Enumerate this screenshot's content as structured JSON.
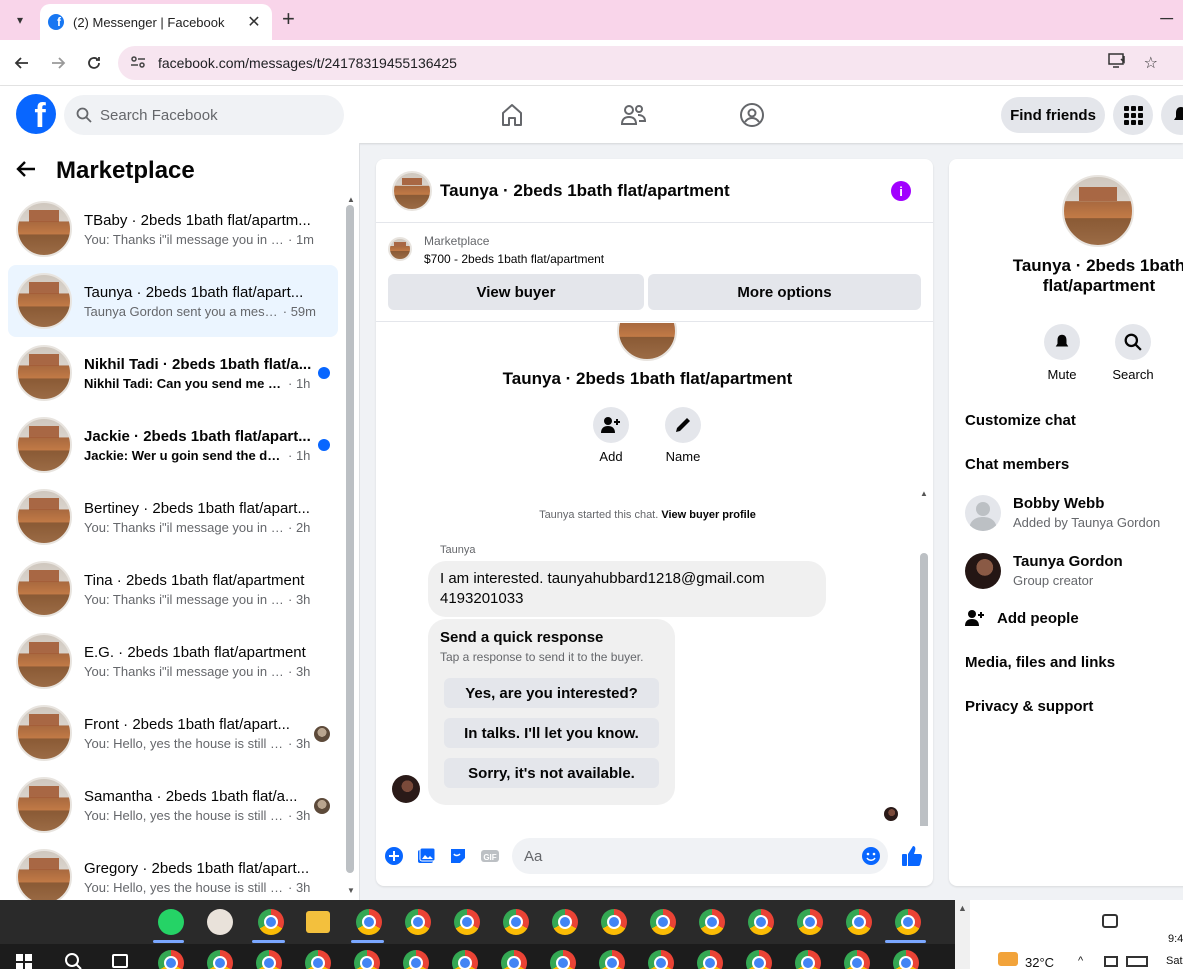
{
  "browser": {
    "tab_title": "(2) Messenger | Facebook",
    "tab_close": "✕",
    "new_tab": "+",
    "minimize": "─",
    "url": "facebook.com/messages/t/24178319455136425"
  },
  "header": {
    "logo_letter": "f",
    "search_placeholder": "Search Facebook",
    "find_friends": "Find friends"
  },
  "left": {
    "title": "Marketplace",
    "conversations": [
      {
        "name": "TBaby · 2beds 1bath flat/apartm...",
        "snippet": "You: Thanks i\"il message you in a ...",
        "time": "· 1m",
        "active": false,
        "unread": false,
        "indicator": "none"
      },
      {
        "name": "Taunya · 2beds 1bath flat/apart...",
        "snippet": "Taunya Gordon sent you a messa...",
        "time": "· 59m",
        "active": true,
        "unread": false,
        "indicator": "none"
      },
      {
        "name": "Nikhil Tadi · 2beds 1bath flat/a...",
        "snippet": "Nikhil Tadi: Can you send me ad...",
        "time": "· 1h",
        "active": false,
        "unread": true,
        "indicator": "dot"
      },
      {
        "name": "Jackie · 2beds 1bath flat/apart...",
        "snippet": "Jackie: Wer u goin send the det...",
        "time": "· 1h",
        "active": false,
        "unread": true,
        "indicator": "dot"
      },
      {
        "name": "Bertiney · 2beds 1bath flat/apart...",
        "snippet": "You: Thanks i\"il message you in a ...",
        "time": "· 2h",
        "active": false,
        "unread": false,
        "indicator": "none"
      },
      {
        "name": "Tina · 2beds 1bath flat/apartment",
        "snippet": "You: Thanks i\"il message you in a ...",
        "time": "· 3h",
        "active": false,
        "unread": false,
        "indicator": "none"
      },
      {
        "name": "E.G. · 2beds 1bath flat/apartment",
        "snippet": "You: Thanks i\"il message you in a ...",
        "time": "· 3h",
        "active": false,
        "unread": false,
        "indicator": "none"
      },
      {
        "name": "Front · 2beds 1bath flat/apart...",
        "snippet": "You: Hello, yes the house is still a...",
        "time": "· 3h",
        "active": false,
        "unread": false,
        "indicator": "avatar"
      },
      {
        "name": "Samantha · 2beds 1bath flat/a...",
        "snippet": "You: Hello, yes the house is still a...",
        "time": "· 3h",
        "active": false,
        "unread": false,
        "indicator": "avatar"
      },
      {
        "name": "Gregory · 2beds 1bath flat/apart...",
        "snippet": "You: Hello, yes the house is still avai...",
        "time": "· 3h",
        "active": false,
        "unread": false,
        "indicator": "none"
      }
    ]
  },
  "chat": {
    "title": "Taunya · 2beds 1bath flat/apartment",
    "info_icon": "i",
    "marketplace_label": "Marketplace",
    "listing": "$700 - 2beds 1bath flat/apartment",
    "view_buyer": "View buyer",
    "more_options": "More options",
    "center_title": "Taunya · 2beds 1bath flat/apartment",
    "add_label": "Add",
    "name_label": "Name",
    "started_text": "Taunya started this chat.",
    "view_buyer_profile": "View buyer profile",
    "sender": "Taunya",
    "message_line1": "I am interested. taunyahubbard1218@gmail.com",
    "message_line2": "4193201033",
    "quick_title": "Send a quick response",
    "quick_sub": "Tap a response to send it to the buyer.",
    "quick_options": [
      "Yes, are you interested?",
      "In talks. I'll let you know.",
      "Sorry, it's not available."
    ],
    "composer_placeholder": "Aa"
  },
  "right": {
    "title": "Taunya · 2beds 1bath flat/apartment",
    "mute": "Mute",
    "search": "Search",
    "customize_chat": "Customize chat",
    "chat_members": "Chat members",
    "members": [
      {
        "name": "Bobby Webb",
        "sub": "Added by Taunya Gordon"
      },
      {
        "name": "Taunya Gordon",
        "sub": "Group creator"
      }
    ],
    "add_people": "Add people",
    "media": "Media, files and links",
    "privacy": "Privacy & support"
  },
  "taskbar": {
    "temperature": "32°C",
    "time": "9:4",
    "day": "Sat"
  },
  "colors": {
    "brand": "#0866ff",
    "info": "#a100ff",
    "active_row": "#ebf5ff",
    "tab_bar": "#f9d5ea"
  }
}
